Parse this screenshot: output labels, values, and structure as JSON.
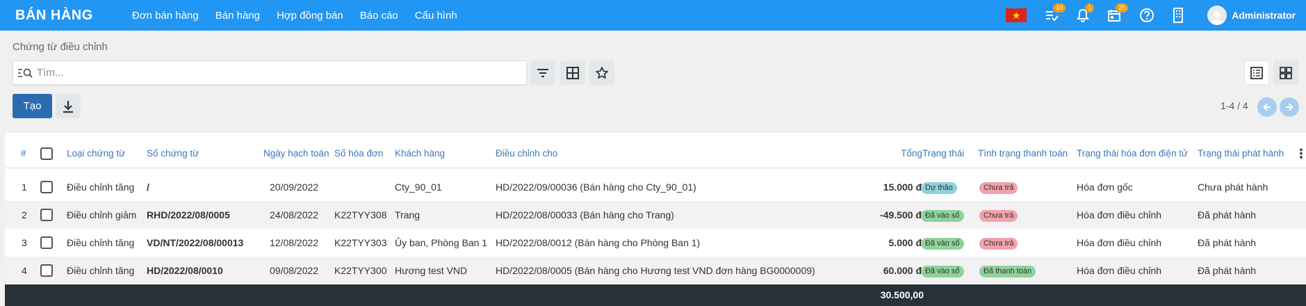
{
  "app": {
    "brand": "BÁN HÀNG",
    "user": "Administrator"
  },
  "menu": [
    "Đơn bán hàng",
    "Bán hàng",
    "Hợp đồng bán",
    "Báo cáo",
    "Cấu hình"
  ],
  "badges": {
    "activities": "10",
    "notifications": "1",
    "calendar": "25"
  },
  "colors": {
    "topbar": "#2196f3",
    "create_button": "#2b6cb0",
    "footer": "#263238",
    "header_text": "#3c76b8"
  },
  "breadcrumb": "Chứng từ điều chỉnh",
  "search": {
    "placeholder": "Tìm..."
  },
  "actions": {
    "create": "Tạo"
  },
  "pager": "1-4 / 4",
  "columns": [
    "#",
    "Loại chứng từ",
    "Số chứng từ",
    "Ngày hạch toán",
    "Số hóa đơn",
    "Khách hàng",
    "Điều chỉnh cho",
    "Tổng",
    "Trạng thái",
    "Tình trạng thanh toán",
    "Trạng thái hóa đơn điện tử",
    "Trạng thái phát hành"
  ],
  "rows": [
    {
      "idx": "1",
      "type": "Điều chỉnh tăng",
      "number": "/",
      "date": "20/09/2022",
      "invoice": "",
      "customer": "Cty_90_01",
      "adjust_for": "HD/2022/09/00036 (Bán hàng cho Cty_90_01)",
      "total": "15.000 đ",
      "status": "Dự thảo",
      "status_color": "#8fd1dc",
      "payment": "Chưa trả",
      "payment_color": "#f1a3ab",
      "einvoice": "Hóa đơn gốc",
      "release": "Chưa phát hành"
    },
    {
      "idx": "2",
      "type": "Điều chỉnh giảm",
      "number": "RHD/2022/08/0005",
      "date": "24/08/2022",
      "invoice": "K22TYY308",
      "customer": "Trang",
      "adjust_for": "HD/2022/08/00033 (Bán hàng cho Trang)",
      "total": "-49.500 đ",
      "status": "Đã vào sổ",
      "status_color": "#8ed39a",
      "payment": "Chưa trả",
      "payment_color": "#f1a3ab",
      "einvoice": "Hóa đơn điều chỉnh",
      "release": "Đã phát hành"
    },
    {
      "idx": "3",
      "type": "Điều chỉnh tăng",
      "number": "VD/NT/2022/08/00013",
      "date": "12/08/2022",
      "invoice": "K22TYY303",
      "customer": "Ủy ban, Phòng Ban 1",
      "adjust_for": "HD/2022/08/0012 (Bán hàng cho Phòng Ban 1)",
      "total": "5.000 đ",
      "status": "Đã vào sổ",
      "status_color": "#8ed39a",
      "payment": "Chưa trả",
      "payment_color": "#f1a3ab",
      "einvoice": "Hóa đơn điều chỉnh",
      "release": "Đã phát hành"
    },
    {
      "idx": "4",
      "type": "Điều chỉnh tăng",
      "number": "HD/2022/08/0010",
      "date": "09/08/2022",
      "invoice": "K22TYY300",
      "customer": "Hương test VND",
      "adjust_for": "HD/2022/08/0005 (Bán hàng cho Hương test VND đơn hàng BG0000009)",
      "total": "60.000 đ",
      "status": "Đã vào sổ",
      "status_color": "#8ed39a",
      "payment": "Đã thanh toán",
      "payment_color": "#8ed39a",
      "einvoice": "Hóa đơn điều chỉnh",
      "release": "Đã phát hành"
    }
  ],
  "footer_total": "30.500,00"
}
